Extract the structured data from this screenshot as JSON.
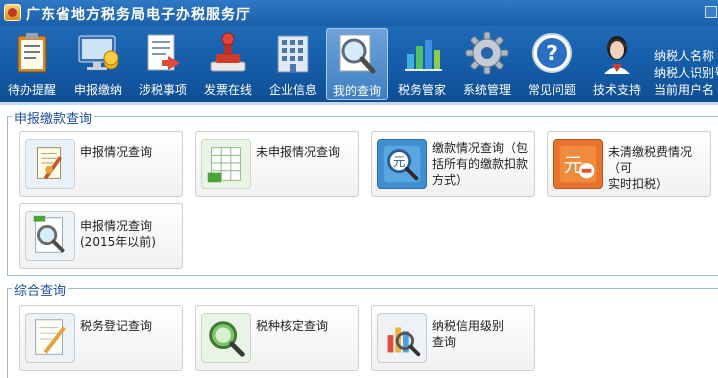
{
  "window": {
    "title": "广东省地方税务局电子办税服务厅"
  },
  "toolbar": {
    "items": [
      {
        "label": "待办提醒",
        "icon": "clipboard-icon"
      },
      {
        "label": "申报缴纳",
        "icon": "monitor-coins-icon"
      },
      {
        "label": "涉税事项",
        "icon": "document-arrow-icon"
      },
      {
        "label": "发票在线",
        "icon": "stamp-icon"
      },
      {
        "label": "企业信息",
        "icon": "building-icon"
      },
      {
        "label": "我的查询",
        "icon": "magnifier-icon"
      },
      {
        "label": "税务管家",
        "icon": "bar-chart-icon"
      },
      {
        "label": "系统管理",
        "icon": "gear-icon"
      },
      {
        "label": "常见问题",
        "icon": "help-icon"
      },
      {
        "label": "技术支持",
        "icon": "support-agent-icon"
      }
    ]
  },
  "user": {
    "line1": "纳税人名称",
    "line2": "纳税人识别号",
    "line3": "当前用户名"
  },
  "sections": {
    "declare": {
      "title": "申报缴款查询",
      "cards": [
        {
          "lines": [
            "申报情况查询"
          ]
        },
        {
          "lines": [
            "未申报情况查询"
          ]
        },
        {
          "lines": [
            "缴款情况查询（包",
            "括所有的缴款扣款",
            "方式）"
          ]
        },
        {
          "lines": [
            "未清缴税费情况（可",
            "实时扣税）"
          ]
        },
        {
          "lines": [
            "申报情况查询",
            "(2015年以前)"
          ]
        }
      ]
    },
    "general": {
      "title": "综合查询",
      "cards": [
        {
          "lines": [
            "税务登记查询"
          ]
        },
        {
          "lines": [
            "税种核定查询"
          ]
        },
        {
          "lines": [
            "纳税信用级别",
            "查询"
          ]
        }
      ]
    }
  },
  "colors": {
    "header_blue": "#1b5fa8",
    "section_title": "#1b4fa0"
  }
}
